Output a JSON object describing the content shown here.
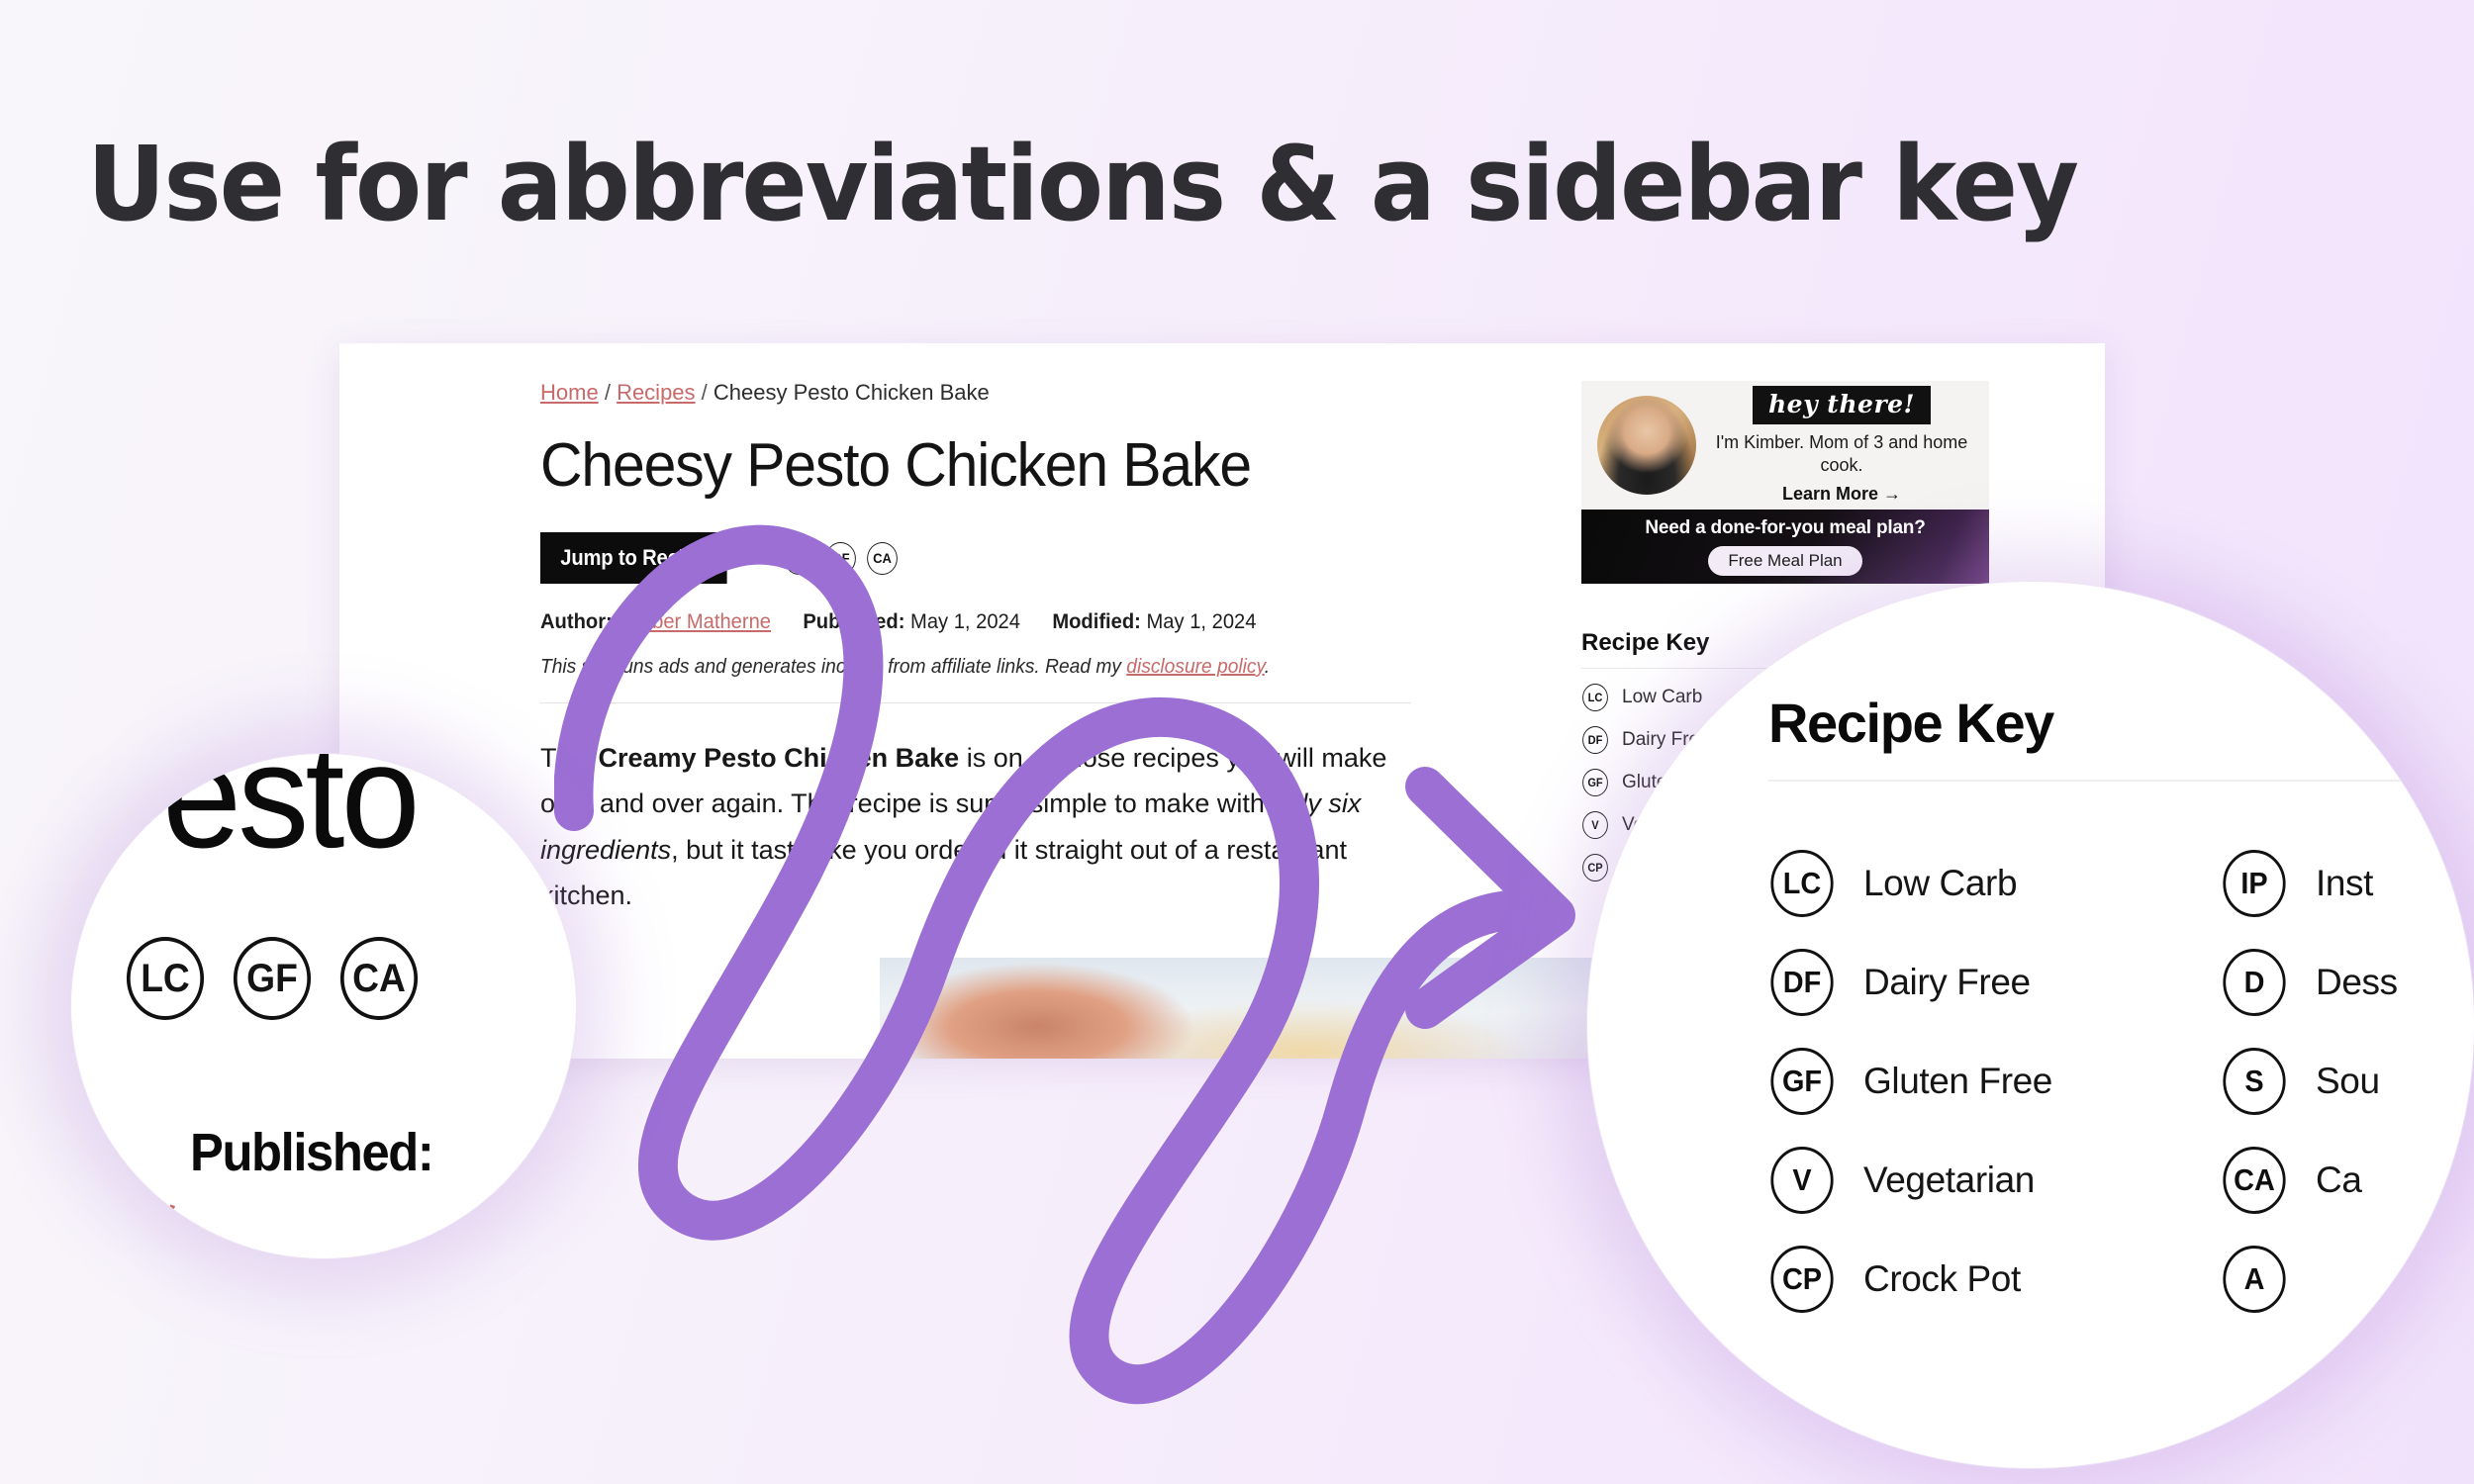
{
  "headline": "Use for abbreviations & a sidebar key",
  "page": {
    "breadcrumb": {
      "home": "Home",
      "recipes": "Recipes",
      "sep": "/",
      "current": "Cheesy Pesto Chicken Bake"
    },
    "title": "Cheesy Pesto Chicken Bake",
    "jump_to_recipe": "Jump to Recipe",
    "tags": [
      "LC",
      "GF",
      "CA"
    ],
    "meta": {
      "author_label": "Author:",
      "author_name": "Kimber Matherne",
      "published_label": "Published:",
      "published_date": "May 1, 2024",
      "modified_label": "Modified:",
      "modified_date": "May 1, 2024"
    },
    "disclosure": {
      "text": "This site runs ads and generates income from affiliate links. Read my ",
      "link": "disclosure policy",
      "end": "."
    },
    "body": {
      "p1_a": "This ",
      "p1_b": "Creamy Pesto Chicken Bake",
      "p1_c": " is on of those recipes you will make over and over again. This recipe is super simple to make with ",
      "p1_d": "only six ingredients",
      "p1_e": ", but it taste like you ordered it straight out of a restaurant kitchen."
    }
  },
  "sidebar": {
    "hey_there": "hey there!",
    "bio": "I'm Kimber. Mom of 3 and home cook.",
    "learn_more": "Learn More  →",
    "cta_heading": "Need a done-for-you meal plan?",
    "cta_button": "Free Meal Plan",
    "recipe_key_title": "Recipe Key",
    "recipe_key": [
      {
        "abbr": "LC",
        "label": "Low Carb"
      },
      {
        "abbr": "DF",
        "label": "Dairy Free"
      },
      {
        "abbr": "GF",
        "label": "Gluten Free"
      },
      {
        "abbr": "V",
        "label": "Vegetarian"
      },
      {
        "abbr": "CP",
        "label": "Crock Pot"
      }
    ]
  },
  "magnifier_left": {
    "partial_title": "esto",
    "tags": [
      "LC",
      "GF",
      "CA"
    ],
    "published_label": "Published:"
  },
  "magnifier_right": {
    "title": "Recipe Key",
    "column_1": [
      {
        "abbr": "LC",
        "label": "Low Carb"
      },
      {
        "abbr": "DF",
        "label": "Dairy Free"
      },
      {
        "abbr": "GF",
        "label": "Gluten Free"
      },
      {
        "abbr": "V",
        "label": "Vegetarian"
      },
      {
        "abbr": "CP",
        "label": "Crock Pot"
      }
    ],
    "column_2": [
      {
        "abbr": "IP",
        "label": "Inst"
      },
      {
        "abbr": "D",
        "label": "Dess"
      },
      {
        "abbr": "S",
        "label": "Sou"
      },
      {
        "abbr": "CA",
        "label": "Ca"
      },
      {
        "abbr": "A",
        "label": ""
      }
    ]
  },
  "colors": {
    "accent_purple": "#9b6fd4",
    "link_red": "#c86a6a",
    "bg_start": "#f8f6fa",
    "bg_end": "#f1e2fb",
    "ink": "#141414"
  }
}
